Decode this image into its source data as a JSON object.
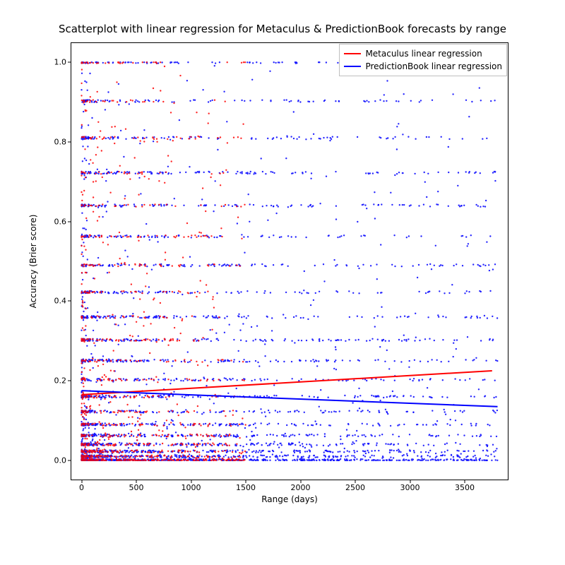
{
  "chart_data": {
    "type": "scatter",
    "title": "Scatterplot with linear regression for Metaculus & PredictionBook forecasts by range",
    "xlabel": "Range (days)",
    "ylabel": "Accuracy (Brier score)",
    "xlim": [
      -100,
      3900
    ],
    "ylim": [
      -0.05,
      1.05
    ],
    "xticks": [
      0,
      500,
      1000,
      1500,
      2000,
      2500,
      3000,
      3500
    ],
    "yticks": [
      0.0,
      0.2,
      0.4,
      0.6,
      0.8,
      1.0
    ],
    "series": [
      {
        "name": "Metaculus linear regression",
        "color": "#ff0000",
        "type": "line",
        "points": [
          [
            0,
            0.165
          ],
          [
            3750,
            0.225
          ]
        ]
      },
      {
        "name": "PredictionBook linear regression",
        "color": "#0000ff",
        "type": "line",
        "points": [
          [
            0,
            0.175
          ],
          [
            3800,
            0.135
          ]
        ]
      }
    ],
    "scatter_description": "Dense scatter of red (Metaculus) and blue (PredictionBook) points. Blue points span x=0..3800, y=0..1.0 with strong horizontal banding at discrete Brier-score levels and concentration at low x. Red points span roughly x=0..1500, y=0..1.0, concentrated in 0..800 range.",
    "brier_bands": [
      0.0,
      0.01,
      0.0225,
      0.04,
      0.0625,
      0.09,
      0.1225,
      0.16,
      0.2025,
      0.25,
      0.3025,
      0.36,
      0.4225,
      0.49,
      0.5625,
      0.64,
      0.7225,
      0.81,
      0.9025,
      1.0
    ]
  },
  "legend": {
    "entries": [
      {
        "label": "Metaculus linear regression",
        "color": "#ff0000"
      },
      {
        "label": "PredictionBook linear regression",
        "color": "#0000ff"
      }
    ]
  }
}
